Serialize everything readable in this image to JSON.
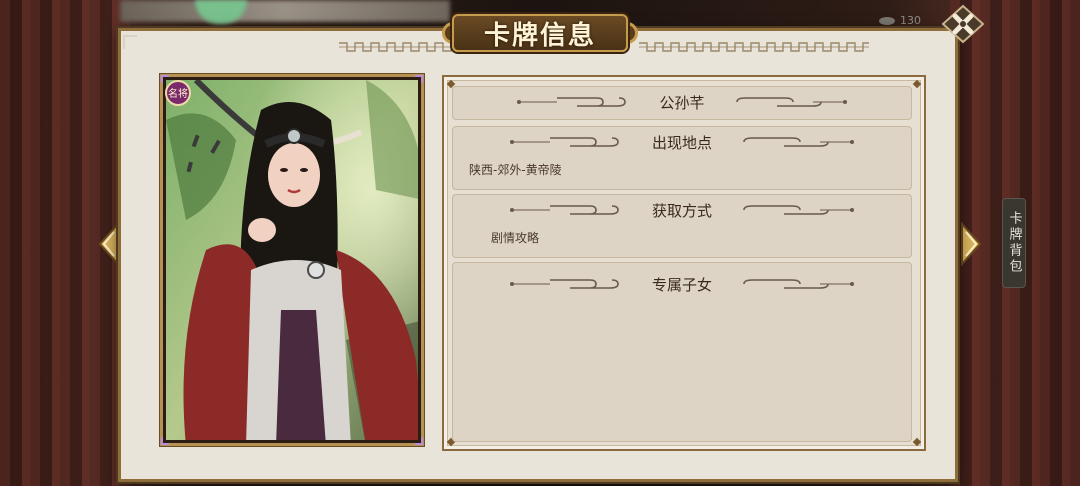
{
  "title": "卡牌信息",
  "top_status": {
    "count": "130"
  },
  "card": {
    "name": "公孙芊",
    "rarity_badge": "名将",
    "colors": {
      "frame": "#b59154",
      "badge": "#7a2a6a"
    }
  },
  "sections": [
    {
      "title": "公孙芊",
      "body": ""
    },
    {
      "title": "出现地点",
      "body": "陕西-郊外-黄帝陵"
    },
    {
      "title": "获取方式",
      "body": "剧情攻略"
    },
    {
      "title": "专属子女",
      "body": ""
    }
  ],
  "side_tab": {
    "label": "卡牌背包"
  },
  "icons": {
    "close": "close-x-icon",
    "prev": "arrow-left-icon",
    "next": "arrow-right-icon"
  },
  "colors": {
    "panel_bg": "#e9e4da",
    "gold": "#c59b4c",
    "text_dark": "#3a2a1c"
  }
}
